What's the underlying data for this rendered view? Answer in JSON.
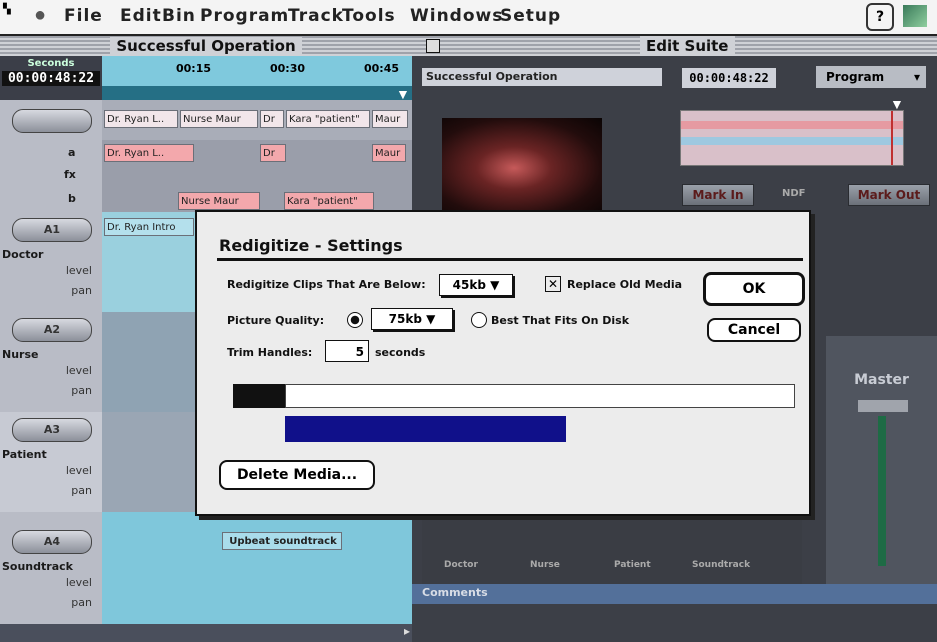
{
  "menubar": {
    "items": [
      "File",
      "Edit",
      "Bin",
      "Program",
      "Track",
      "Tools",
      "Windows",
      "Setup"
    ]
  },
  "timeline": {
    "title": "Successful Operation",
    "seconds_label": "Seconds",
    "timecode": "00:00:48:22",
    "ruler_ticks": [
      "00:15",
      "00:30",
      "00:45"
    ],
    "video_clips": [
      "Dr. Ryan L..",
      "Nurse Maur",
      "Dr",
      "Kara \"patient\"",
      "Maur"
    ],
    "track_a": "a",
    "track_fx": "fx",
    "track_b": "b",
    "a_clips": [
      "Dr. Ryan L..",
      "Dr",
      "Maur"
    ],
    "b_clips": [
      "Nurse Maur",
      "Kara \"patient\""
    ],
    "intro_clip": "Dr. Ryan Intro",
    "tracks": [
      {
        "button": "A1",
        "name": "Doctor"
      },
      {
        "button": "A2",
        "name": "Nurse"
      },
      {
        "button": "A3",
        "name": "Patient"
      },
      {
        "button": "A4",
        "name": "Soundtrack"
      }
    ],
    "level_label": "level",
    "pan_label": "pan",
    "soundtrack_clip": "Upbeat soundtrack"
  },
  "edit_suite": {
    "title": "Edit Suite",
    "clip_name": "Successful Operation",
    "timecode": "00:00:48:22",
    "mode": "Program",
    "mark_in": "Mark In",
    "ndf": "NDF",
    "mark_out": "Mark Out",
    "mixer_label": "Master",
    "channels": [
      "Doctor",
      "Nurse",
      "Patient",
      "Soundtrack"
    ],
    "comments": "Comments"
  },
  "dialog": {
    "title": "Redigitize - Settings",
    "clips_below_label": "Redigitize Clips That Are Below:",
    "clips_below_value": "45kb",
    "replace_label": "Replace Old Media",
    "replace_checked": true,
    "quality_label": "Picture Quality:",
    "quality_value": "75kb",
    "best_fit_label": "Best That Fits On Disk",
    "quality_selected": "75kb",
    "trim_label": "Trim Handles:",
    "trim_value": "5",
    "trim_unit": "seconds",
    "ok": "OK",
    "cancel": "Cancel",
    "delete_media": "Delete Media...",
    "progress_fraction": 0.55
  }
}
